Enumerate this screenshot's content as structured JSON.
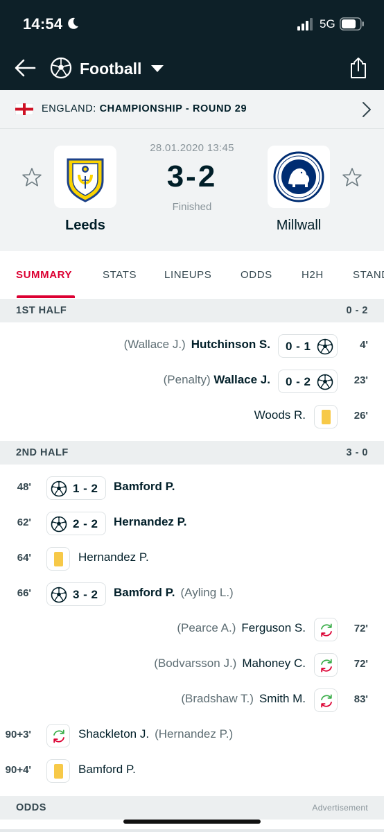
{
  "status_bar": {
    "time": "14:54",
    "network": "5G"
  },
  "nav": {
    "sport": "Football"
  },
  "breadcrumb": {
    "country": "ENGLAND:",
    "league": "CHAMPIONSHIP - ROUND 29"
  },
  "match": {
    "datetime": "28.01.2020 13:45",
    "score": "3-2",
    "status": "Finished",
    "home_team": "Leeds",
    "away_team": "Millwall"
  },
  "tabs": [
    "SUMMARY",
    "STATS",
    "LINEUPS",
    "ODDS",
    "H2H",
    "STANDINGS"
  ],
  "sections": {
    "first_half": {
      "label": "1ST HALF",
      "result": "0 - 2"
    },
    "second_half": {
      "label": "2ND HALF",
      "result": "3 - 0"
    },
    "odds": {
      "label": "ODDS",
      "ad_label": "Advertisement"
    }
  },
  "incidents": [
    {
      "minute": "4'",
      "assist": "(Wallace J.)",
      "player": "Hutchinson S.",
      "score": "0 - 1"
    },
    {
      "minute": "23'",
      "assist": "(Penalty)",
      "player": "Wallace J.",
      "score": "0 - 2"
    },
    {
      "minute": "26'",
      "player": "Woods R."
    },
    {
      "minute": "48'",
      "score": "1 - 2",
      "player": "Bamford P."
    },
    {
      "minute": "62'",
      "score": "2 - 2",
      "player": "Hernandez P."
    },
    {
      "minute": "64'",
      "player": "Hernandez P."
    },
    {
      "minute": "66'",
      "score": "3 - 2",
      "player": "Bamford P.",
      "assist": "(Ayling L.)"
    },
    {
      "minute": "72'",
      "assist": "(Pearce A.)",
      "player": "Ferguson S."
    },
    {
      "minute": "72'",
      "assist": "(Bodvarsson J.)",
      "player": "Mahoney C."
    },
    {
      "minute": "83'",
      "assist": "(Bradshaw T.)",
      "player": "Smith M."
    },
    {
      "minute": "90+3'",
      "player": "Shackleton J.",
      "assist": "(Hernandez P.)"
    },
    {
      "minute": "90+4'",
      "player": "Bamford P."
    }
  ],
  "colors": {
    "header_bg": "#0d2028",
    "accent": "#dc0032",
    "yellow_card": "#f7c948"
  },
  "icons": [
    "back-arrow-icon",
    "soccer-ball-icon",
    "dropdown-caret-icon",
    "share-icon",
    "england-flag-icon",
    "chevron-right-icon",
    "star-icon",
    "yellow-card-icon",
    "substitution-icon"
  ]
}
